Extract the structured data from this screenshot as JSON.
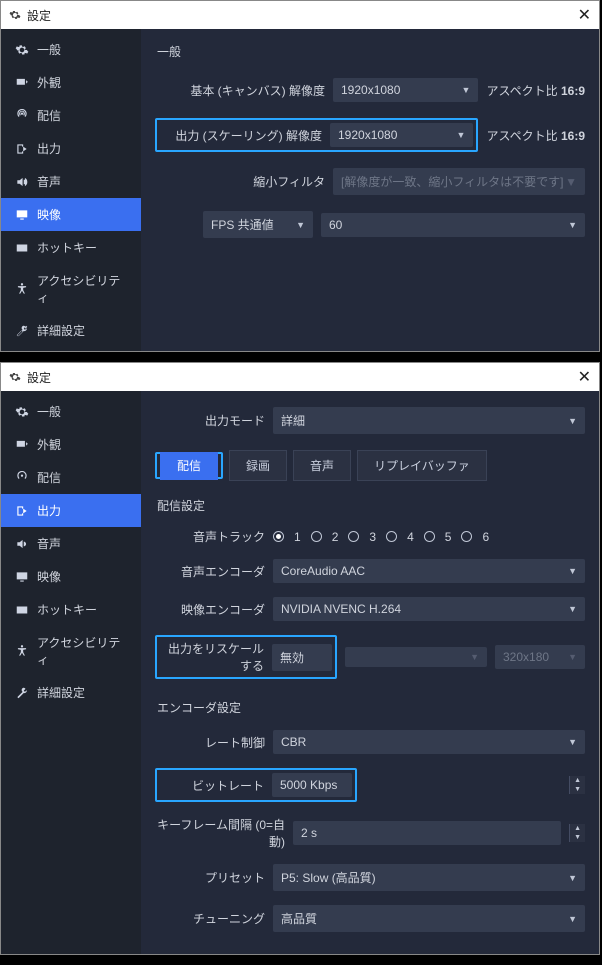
{
  "title": "設定",
  "sidebar1": {
    "items": [
      {
        "label": "一般"
      },
      {
        "label": "外観"
      },
      {
        "label": "配信"
      },
      {
        "label": "出力"
      },
      {
        "label": "音声"
      },
      {
        "label": "映像"
      },
      {
        "label": "ホットキー"
      },
      {
        "label": "アクセシビリティ"
      },
      {
        "label": "詳細設定"
      }
    ]
  },
  "panel1": {
    "section": "一般",
    "base_label": "基本 (キャンバス) 解像度",
    "base_value": "1920x1080",
    "aspect_prefix": "アスペクト比 ",
    "aspect_value": "16:9",
    "output_label": "出力 (スケーリング) 解像度",
    "output_value": "1920x1080",
    "filter_label": "縮小フィルタ",
    "filter_value": "[解像度が一致、縮小フィルタは不要です]",
    "fps_mode": "FPS 共通値",
    "fps_value": "60"
  },
  "sidebar2": {
    "items": [
      {
        "label": "一般"
      },
      {
        "label": "外観"
      },
      {
        "label": "配信"
      },
      {
        "label": "出力"
      },
      {
        "label": "音声"
      },
      {
        "label": "映像"
      },
      {
        "label": "ホットキー"
      },
      {
        "label": "アクセシビリティ"
      },
      {
        "label": "詳細設定"
      }
    ]
  },
  "panel2": {
    "mode_label": "出力モード",
    "mode_value": "詳細",
    "tabs": {
      "stream": "配信",
      "record": "録画",
      "audio": "音声",
      "replay": "リプレイバッファ"
    },
    "stream_settings_title": "配信設定",
    "audio_track_label": "音声トラック",
    "tracks": [
      "1",
      "2",
      "3",
      "4",
      "5",
      "6"
    ],
    "audio_enc_label": "音声エンコーダ",
    "audio_enc_value": "CoreAudio AAC",
    "video_enc_label": "映像エンコーダ",
    "video_enc_value": "NVIDIA NVENC H.264",
    "rescale_label": "出力をリスケールする",
    "rescale_value": "無効",
    "rescale_res": "320x180",
    "encoder_settings_title": "エンコーダ設定",
    "rate_label": "レート制御",
    "rate_value": "CBR",
    "bitrate_label": "ビットレート",
    "bitrate_value": "5000 Kbps",
    "keyframe_label": "キーフレーム間隔 (0=自動)",
    "keyframe_value": "2 s",
    "preset_label": "プリセット",
    "preset_value": "P5: Slow (高品質)",
    "tuning_label": "チューニング",
    "tuning_value": "高品質"
  }
}
